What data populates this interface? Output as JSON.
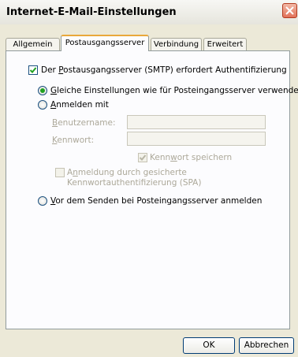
{
  "window": {
    "title": "Internet-E-Mail-Einstellungen"
  },
  "tabs": [
    {
      "label": "Allgemein"
    },
    {
      "label": "Postausgangsserver",
      "active": true
    },
    {
      "label": "Verbindung"
    },
    {
      "label": "Erweitert"
    }
  ],
  "smtp_auth": {
    "checked": true,
    "label_prefix": "Der ",
    "label_underlined": "P",
    "label_rest": "ostausgangsserver (SMTP) erfordert Authentifizierung"
  },
  "option_same": {
    "selected": true,
    "label_underlined": "G",
    "label_rest": "leiche Einstellungen wie für Posteingangsserver verwenden"
  },
  "option_login": {
    "selected": false,
    "label_underlined": "A",
    "label_rest": "nmelden mit"
  },
  "username": {
    "label_underlined": "B",
    "label_rest": "enutzername:",
    "value": ""
  },
  "password": {
    "label_underlined": "K",
    "label_rest": "ennwort:",
    "value": ""
  },
  "save_password": {
    "checked": true,
    "label_prefix": "Kenn",
    "label_underlined": "w",
    "label_rest": "ort speichern"
  },
  "spa": {
    "checked": false,
    "line1_prefix": "A",
    "line1_underlined": "n",
    "line1_rest": "meldung durch gesicherte",
    "line2": "Kennwortauthentifizierung (SPA)"
  },
  "option_before_send": {
    "selected": false,
    "label_underlined": "V",
    "label_rest": "or dem Senden bei Posteingangsserver anmelden"
  },
  "buttons": {
    "ok": "OK",
    "cancel": "Abbrechen"
  },
  "colors": {
    "dialog_bg": "#ece9d8",
    "panel_bg": "#fcfcfe",
    "tab_accent": "#e9a83b",
    "check_green": "#21a121",
    "close_red": "#e2725a",
    "disabled_text": "#aca899"
  }
}
